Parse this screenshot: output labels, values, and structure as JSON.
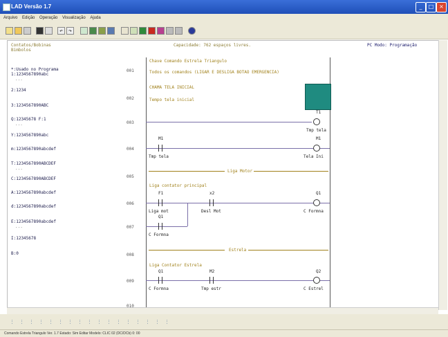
{
  "window": {
    "title": "LAD Versão 1.7"
  },
  "menu": [
    "Arquivo",
    "Edição",
    "Operação",
    "Visualização",
    "Ajuda"
  ],
  "header": {
    "left": "Contatos/Bobinas\nBimbolos",
    "center": "Capacidade: 762 espaços livres.",
    "right": "PC Modo: Programação"
  },
  "variables": [
    {
      "text": "*:Usado no Programa\n1:1234567890abc",
      "dots": true
    },
    {
      "text": "2:1234",
      "dots": false
    },
    {
      "text": "3:1234567890ABC",
      "dots": false
    },
    {
      "text": "Q:12345678 F:1",
      "dots": true
    },
    {
      "text": "Y:1234567890abc",
      "dots": false
    },
    {
      "text": "m:1234567890abcdef",
      "dots": false
    },
    {
      "text": "T:1234567890ABCDEF",
      "dots": true
    },
    {
      "text": "C:1234567890ABCDEF",
      "dots": false
    },
    {
      "text": "A:1234567890abcdef",
      "dots": false
    },
    {
      "text": "d:1234567890abcdef",
      "dots": false
    },
    {
      "text": "E:1234567890abcdef",
      "dots": true
    },
    {
      "text": "I:12345678",
      "dots": false
    },
    {
      "text": "B:0",
      "dots": false
    }
  ],
  "rungs": [
    "001",
    "002",
    "003",
    "004",
    "005",
    "006",
    "007",
    "008",
    "009",
    "010"
  ],
  "ladder": {
    "note1": "Chave Comando Estrela Triangulo",
    "note2": "Todos os comandos (LIGAR E DESLIGA BOTAO EMERGENCIA)",
    "note3": "CHAMA TELA INICIAL",
    "note4": "Tempo tela inicial",
    "r3_coil": "T1",
    "r3_label": "Tmp tela",
    "r4_contact": "M1",
    "r4_label": "Tmp tela",
    "r4_coil": "M1",
    "r4_coil_label": "Tela Ini",
    "sep1": "Liga Motor",
    "note5": "Liga contator principal",
    "r6_c1": "F1",
    "r6_c1_label": "Liga mot",
    "r6_c2": "x2",
    "r6_c2_label": "Desl Mot",
    "r6_coil": "Q1",
    "r6_coil_label": "C Formna",
    "r7_c1": "Q1",
    "r7_c1_label": "C Formna",
    "sep2": "Estrela",
    "note6": "Liga Contator Estrela",
    "r9_c1": "Q1",
    "r9_c1_label": "C Formna",
    "r9_c2": "M2",
    "r9_c2_label": "Tmp estr",
    "r9_coil": "Q2",
    "r9_coil_label": "C Estrel"
  },
  "status": {
    "text": "Comando Estrela Triangulo   Ver. 1.7     Estado: Sim     Editar     Modelo: CLIC 02 (DC/DCb)     0: 00"
  },
  "colors": {
    "titlebar": "#2456c4",
    "panel_bg": "#ffffff",
    "comment": "#a0801a",
    "block": "#1f8b80"
  }
}
